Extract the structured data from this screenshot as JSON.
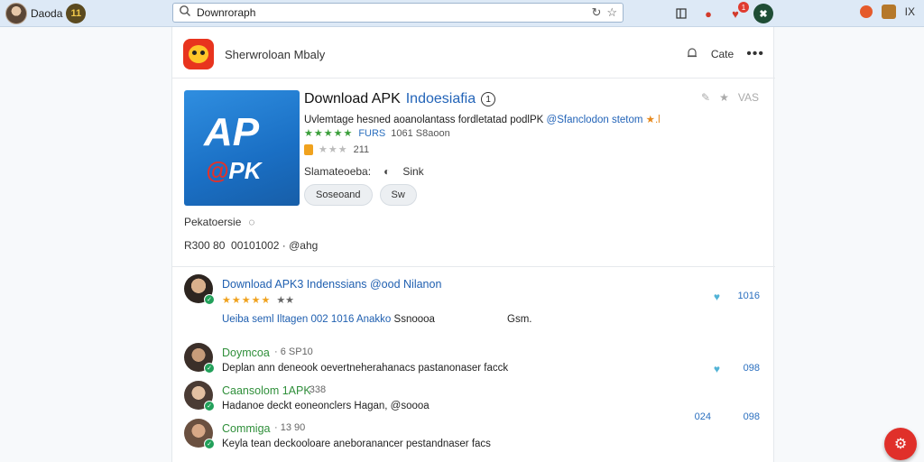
{
  "browser": {
    "profile_name": "Daoda",
    "profile_badge": "11",
    "address_value": "Downroraph",
    "notif_count": "1",
    "right_label": "IX"
  },
  "header": {
    "app_name": "Sherwroloan Mbaly",
    "cate_label": "Cate"
  },
  "app": {
    "icon_big": "AP",
    "icon_small": "PK",
    "title_main": "Download APK",
    "title_accent": "Indoesiafia",
    "top_right_label": "VAS",
    "desc_text": "Uvlemtage hesned aoanolantass fordletatad podlPK",
    "desc_link": "@Sfanclodon stetom",
    "desc_tail": "★.l",
    "rating_stars": "★★★★★",
    "rating_label": "FURS",
    "rating_value": "1061 S8aoon",
    "rating2_value": "211",
    "status_label": "Slamateoeba:",
    "status_value": "Sink",
    "btn_primary": "Soseoand",
    "btn_secondary": "Sw",
    "permissions_label": "Pekatoersie",
    "meta_text": "R300 80  00101002 · @ahg"
  },
  "list": [
    {
      "title": "Download APK3 Indenssians @ood Nilanon",
      "stars": "★★★★★",
      "sub": "★★",
      "text_blue": "Ueiba seml Iltagen 002 1016",
      "text_blue2": "Anakko",
      "text_plain": "Ssnoooa",
      "text_right": "Gsm.",
      "count": "1016"
    },
    {
      "title": "Doymcoa",
      "sub": "· 6 SP10",
      "text": "Deplan ann deneook oevertneherahanacs pastanonaser facck",
      "count": "098"
    },
    {
      "title": "Caansolom 1APK",
      "sub": "· 338",
      "text": "Hadanoe deckt eoneonclers Hagan, @soooa",
      "count_left": "024",
      "count": "098"
    },
    {
      "title": "Commiga",
      "sub": "· 13 90",
      "text": "Keyla tean deckooloare aneboranancer pestandnaser facs"
    }
  ]
}
